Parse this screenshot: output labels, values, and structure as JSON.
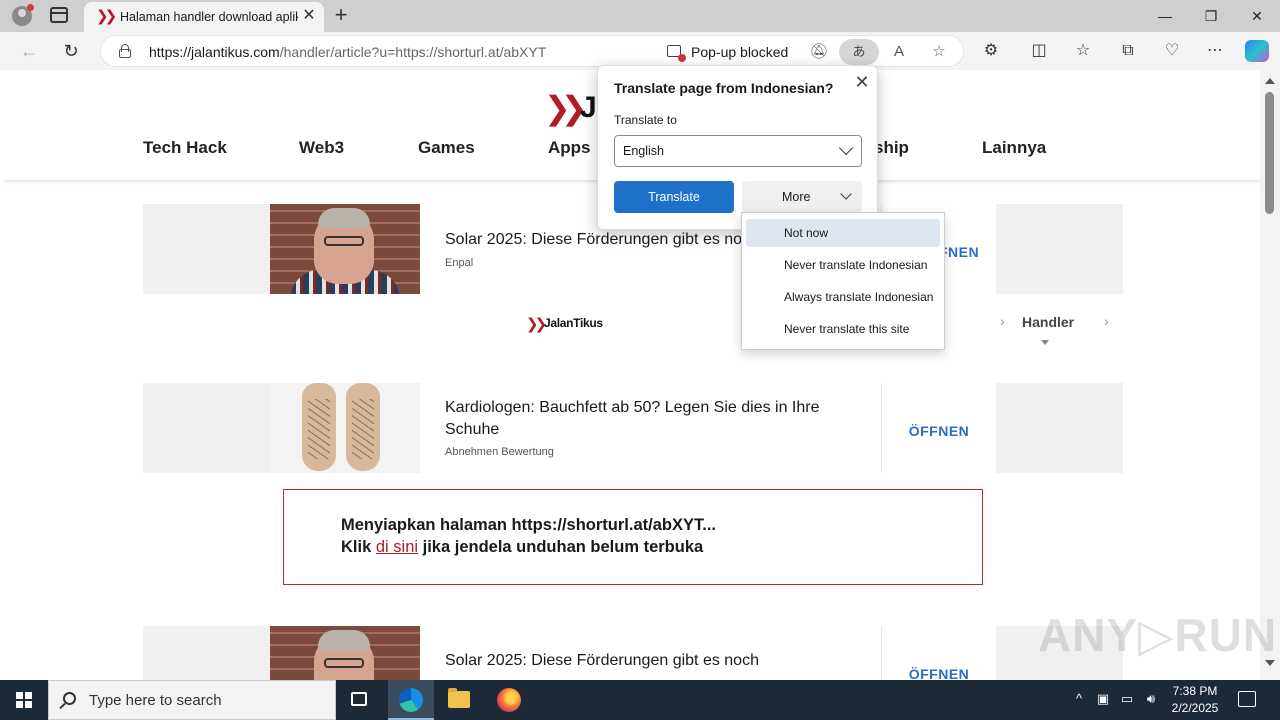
{
  "browser": {
    "tab_title": "Halaman handler download aplik",
    "tab_close": "✕",
    "new_tab": "+",
    "url_domain": "https://jalantikus.com",
    "url_path": "/handler/article?u=https://shorturl.at/abXYT",
    "popup_blocked": "Pop-up blocked",
    "translate_glyph": "あ",
    "window_minimize": "—",
    "window_restore": "❐",
    "window_close": "✕"
  },
  "site": {
    "nav": [
      "Tech Hack",
      "Web3",
      "Games",
      "Apps",
      "ship",
      "Lainnya"
    ],
    "logo_letter": "J",
    "breadcrumb_brand": "JalanTikus",
    "breadcrumb_current": "Handler"
  },
  "ads": [
    {
      "title": "Solar 2025: Diese Förderungen gibt es no",
      "source": "Enpal",
      "cta": "FNEN"
    },
    {
      "title": "Kardiologen: Bauchfett ab 50? Legen Sie dies in Ihre Schuhe",
      "source": "Abnehmen Bewertung",
      "cta": "ÖFFNEN"
    },
    {
      "title": "Solar 2025: Diese Förderungen gibt es noch",
      "source": "",
      "cta": "ÖFFNEN"
    }
  ],
  "notice": {
    "line1": "Menyiapkan halaman https://shorturl.at/abXYT...",
    "line2_prefix": "Klik",
    "link": "di sini",
    "line2_suffix": "jika jendela unduhan belum terbuka"
  },
  "translate_popup": {
    "title": "Translate page from Indonesian?",
    "label": "Translate to",
    "selected_language": "English",
    "translate_button": "Translate",
    "more_button": "More",
    "close": "✕"
  },
  "more_menu": {
    "items": [
      "Not now",
      "Never translate Indonesian",
      "Always translate Indonesian",
      "Never translate this site"
    ],
    "selected_index": 0
  },
  "watermark": "ANY▷RUN",
  "taskbar": {
    "search_placeholder": "Type here to search",
    "time": "7:38 PM",
    "date": "2/2/2025"
  }
}
